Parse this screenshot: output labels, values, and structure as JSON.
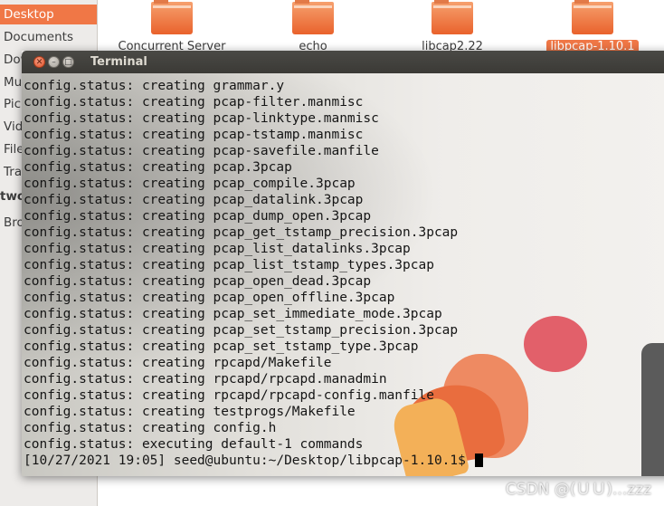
{
  "sidebar": {
    "items": [
      {
        "label": "Desktop"
      },
      {
        "label": "Documents"
      },
      {
        "label": "Dow"
      },
      {
        "label": "Mus"
      },
      {
        "label": "Pic"
      },
      {
        "label": "Vid"
      },
      {
        "label": "File"
      },
      {
        "label": "Tra"
      },
      {
        "label": "two"
      },
      {
        "label": "Bro"
      }
    ]
  },
  "folders": [
    {
      "label": "Concurrent Server"
    },
    {
      "label": "echo"
    },
    {
      "label": "libcap2.22"
    },
    {
      "label": "libpcap-1.10.1"
    }
  ],
  "terminal": {
    "title": "Terminal",
    "lines": [
      "config.status: creating grammar.y",
      "config.status: creating pcap-filter.manmisc",
      "config.status: creating pcap-linktype.manmisc",
      "config.status: creating pcap-tstamp.manmisc",
      "config.status: creating pcap-savefile.manfile",
      "config.status: creating pcap.3pcap",
      "config.status: creating pcap_compile.3pcap",
      "config.status: creating pcap_datalink.3pcap",
      "config.status: creating pcap_dump_open.3pcap",
      "config.status: creating pcap_get_tstamp_precision.3pcap",
      "config.status: creating pcap_list_datalinks.3pcap",
      "config.status: creating pcap_list_tstamp_types.3pcap",
      "config.status: creating pcap_open_dead.3pcap",
      "config.status: creating pcap_open_offline.3pcap",
      "config.status: creating pcap_set_immediate_mode.3pcap",
      "config.status: creating pcap_set_tstamp_precision.3pcap",
      "config.status: creating pcap_set_tstamp_type.3pcap",
      "config.status: creating rpcapd/Makefile",
      "config.status: creating rpcapd/rpcapd.manadmin",
      "config.status: creating rpcapd/rpcapd-config.manfile",
      "config.status: creating testprogs/Makefile",
      "config.status: creating config.h",
      "config.status: executing default-1 commands"
    ],
    "prompt": "[10/27/2021 19:05] seed@ubuntu:~/Desktop/libpcap-1.10.1$ "
  },
  "watermark": "CSDN @(ＵＵ)...zzz",
  "colors": {
    "accent": "#f07746",
    "titlebar": "#3c3b37",
    "terminal_text": "#151515"
  }
}
